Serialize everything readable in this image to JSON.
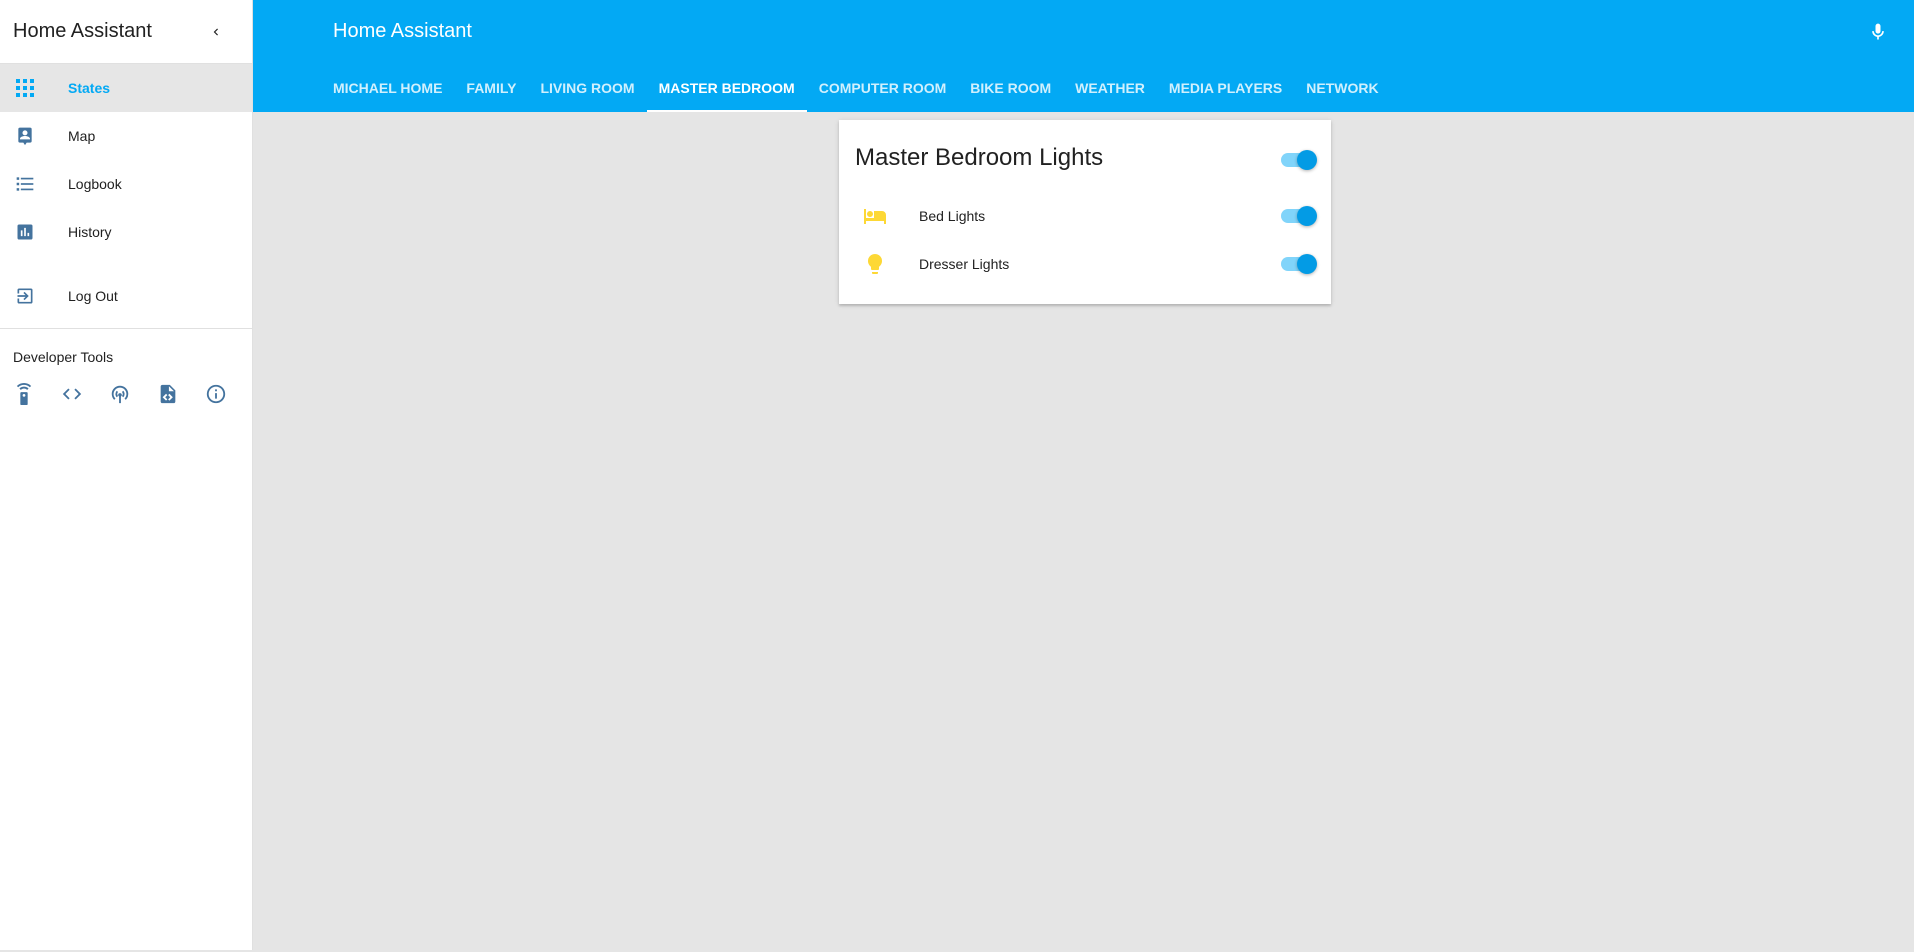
{
  "sidebar": {
    "title": "Home Assistant",
    "items": [
      {
        "label": "States",
        "icon": "apps-grid-icon",
        "active": true
      },
      {
        "label": "Map",
        "icon": "account-location-icon"
      },
      {
        "label": "Logbook",
        "icon": "format-list-bulleted-icon"
      },
      {
        "label": "History",
        "icon": "poll-box-icon"
      },
      {
        "label": "Log Out",
        "icon": "exit-to-app-icon"
      }
    ],
    "developer_tools_label": "Developer Tools",
    "developer_tools": [
      "remote-icon",
      "code-tags-icon",
      "access-point-icon",
      "file-xml-icon",
      "information-outline-icon"
    ]
  },
  "toolbar": {
    "title": "Home Assistant",
    "tabs": [
      "MICHAEL HOME",
      "FAMILY",
      "LIVING ROOM",
      "MASTER BEDROOM",
      "COMPUTER ROOM",
      "BIKE ROOM",
      "WEATHER",
      "MEDIA PLAYERS",
      "NETWORK"
    ],
    "active_tab": "MASTER BEDROOM"
  },
  "card": {
    "title": "Master Bedroom Lights",
    "group_on": true,
    "entities": [
      {
        "name": "Bed Lights",
        "icon": "hotel-bed-icon",
        "on": true
      },
      {
        "name": "Dresser Lights",
        "icon": "lightbulb-icon",
        "on": true
      }
    ]
  },
  "colors": {
    "primary": "#03a9f4",
    "toggle_knob": "#039be5",
    "light_on_icon": "#fdd835",
    "sidebar_icon": "#44739e"
  }
}
